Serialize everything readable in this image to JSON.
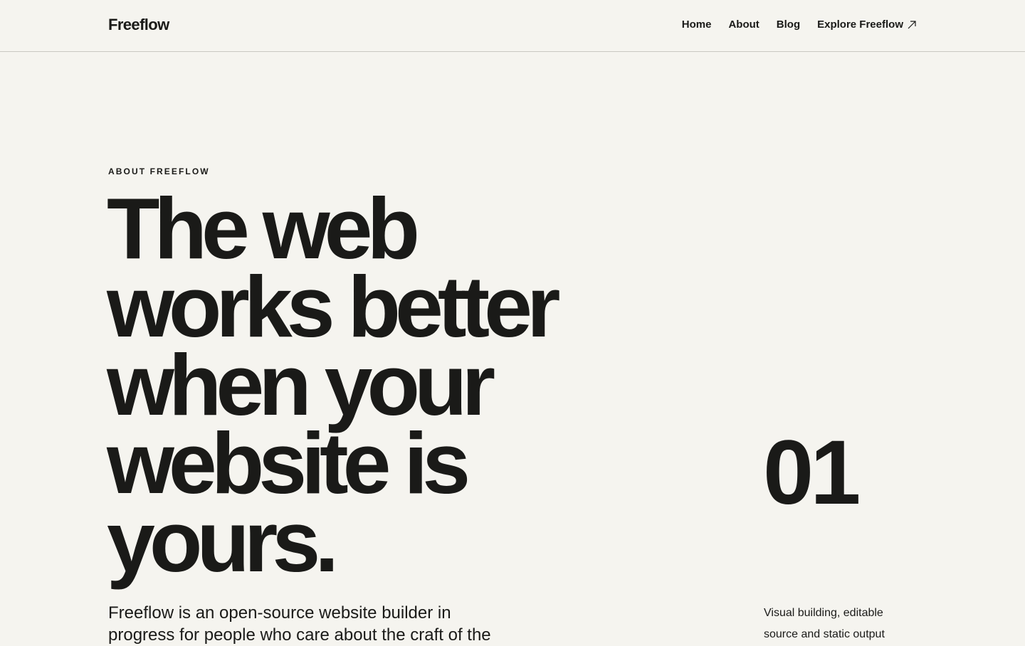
{
  "header": {
    "logo": "Freeflow",
    "nav": {
      "home": "Home",
      "about": "About",
      "blog": "Blog",
      "explore": "Explore Freeflow",
      "explore_icon": "arrow-up-right-icon"
    }
  },
  "hero": {
    "eyebrow": "ABOUT FREEFLOW",
    "headline": "The web works better when your website is yours.",
    "intro": "Freeflow is an open-source website builder in progress for people who care about the craft of the"
  },
  "feature": {
    "number": "01",
    "text": "Visual building, editable source and static output"
  },
  "colors": {
    "background": "#f5f4ef",
    "text": "#1a1a18",
    "divider": "#c9c8c2"
  }
}
